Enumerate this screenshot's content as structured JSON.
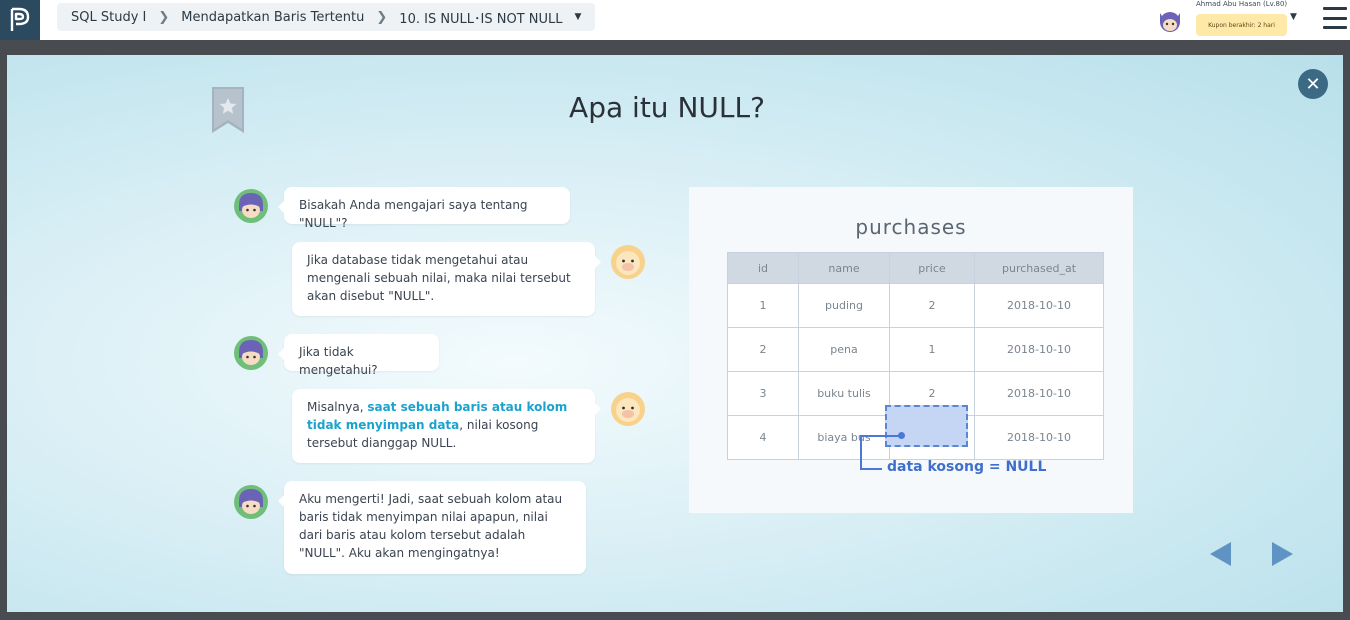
{
  "breadcrumb": {
    "course": "SQL Study I",
    "chapter": "Mendapatkan Baris Tertentu",
    "lesson": "10. IS NULL･IS NOT NULL"
  },
  "user": {
    "name": "Ahmad Abu Hasan (Lv.80)",
    "coupon": "Kupon berakhir: 2 hari"
  },
  "modal": {
    "title": "Apa itu NULL?"
  },
  "chat": [
    {
      "speaker": "student",
      "text": "Bisakah Anda mengajari saya tentang \"NULL\"?"
    },
    {
      "speaker": "teacher",
      "text": "Jika database tidak mengetahui atau mengenali sebuah nilai, maka nilai tersebut akan disebut \"NULL\"."
    },
    {
      "speaker": "student",
      "text": "Jika tidak mengetahui?"
    },
    {
      "speaker": "teacher",
      "prefix": "Misalnya, ",
      "highlight": "saat sebuah baris atau kolom tidak menyimpan data",
      "suffix": ", nilai kosong tersebut dianggap NULL."
    },
    {
      "speaker": "student",
      "text": "Aku mengerti! Jadi, saat sebuah kolom atau baris tidak menyimpan nilai apapun, nilai dari baris atau kolom tersebut adalah \"NULL\". Aku akan mengingatnya!"
    }
  ],
  "table": {
    "title": "purchases",
    "headers": [
      "id",
      "name",
      "price",
      "purchased_at"
    ],
    "rows": [
      [
        "1",
        "puding",
        "2",
        "2018-10-10"
      ],
      [
        "2",
        "pena",
        "1",
        "2018-10-10"
      ],
      [
        "3",
        "buku tulis",
        "2",
        "2018-10-10"
      ],
      [
        "4",
        "biaya bus",
        "",
        "2018-10-10"
      ]
    ],
    "annotation": "data kosong = NULL"
  },
  "icons": {
    "logo": "progate-logo",
    "close": "close-icon",
    "bookmark": "bookmark-star-icon",
    "prev": "arrow-left-icon",
    "next": "arrow-right-icon",
    "menu": "hamburger-menu-icon"
  },
  "colors": {
    "accent": "#1aa3cf",
    "null_highlight": "#c4d6f4",
    "null_border": "#5b86d6",
    "nav_arrow": "#5f93c4",
    "topbar_logo_bg": "#2b4a5f"
  }
}
